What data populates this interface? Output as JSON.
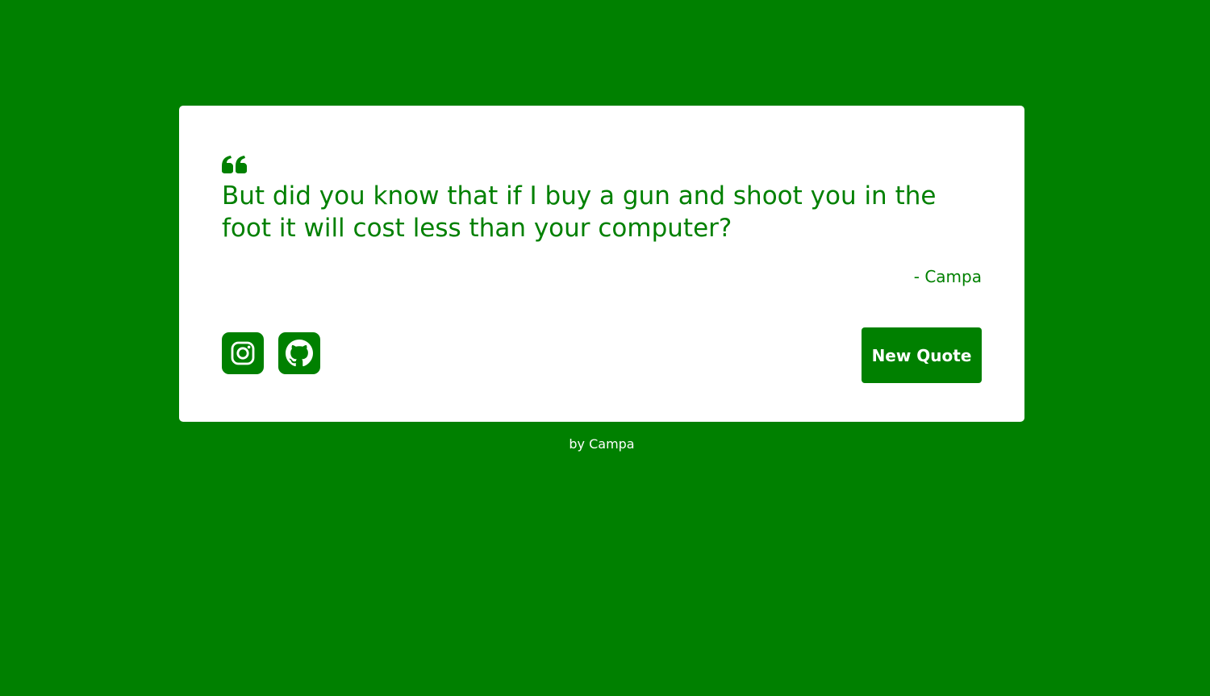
{
  "theme": {
    "background": "#008000",
    "card_background": "#ffffff",
    "accent": "#008000",
    "text_on_accent": "#ffffff"
  },
  "quote": {
    "icon": "quote-left-icon",
    "text": "But did you know that if I buy a gun and shoot you in the foot it will cost less than your computer?",
    "author": "- Campa"
  },
  "social": {
    "instagram_icon": "instagram-icon",
    "github_icon": "github-icon"
  },
  "actions": {
    "new_quote_label": "New Quote"
  },
  "footer": {
    "credit": "by Campa"
  }
}
